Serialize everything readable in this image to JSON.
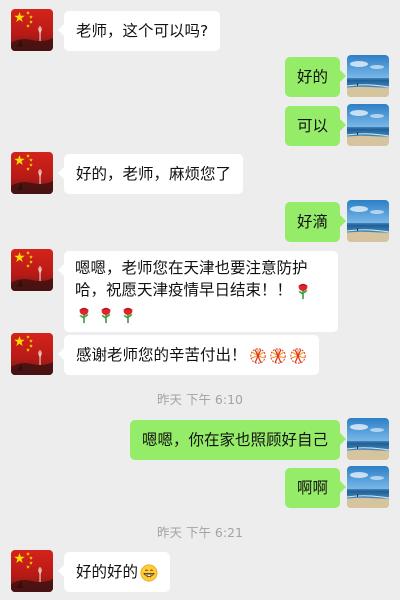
{
  "messages": [
    {
      "side": "in",
      "text": "老师，这个可以吗?"
    },
    {
      "side": "out",
      "text": "好的"
    },
    {
      "side": "out",
      "text": "可以"
    },
    {
      "side": "in",
      "text": "好的，老师，麻烦您了"
    },
    {
      "side": "out",
      "text": "好滴"
    },
    {
      "side": "in",
      "line1": "嗯嗯，老师您在天津也要注意防护",
      "line2": "哈，祝愿天津疫情早日结束！！",
      "emoji": [
        "rose-emoji",
        "rose-emoji",
        "rose-emoji",
        "rose-emoji"
      ]
    },
    {
      "side": "in",
      "text": "感谢老师您的辛苦付出！",
      "emoji": [
        "firecracker-emoji",
        "firecracker-emoji",
        "firecracker-emoji"
      ]
    },
    {
      "side": "out",
      "text": "嗯嗯，你在家也照顾好自己"
    },
    {
      "side": "out",
      "text": "啊啊"
    },
    {
      "side": "in",
      "text": "好的好的",
      "emoji": [
        "grinning-emoji"
      ]
    }
  ],
  "timestamps": [
    "昨天 下午 6:10",
    "昨天 下午 6:21"
  ],
  "colors": {
    "background": "#ededed",
    "outgoing": "#95ec69",
    "incoming": "#ffffff",
    "timestamp": "#a3a3a3"
  }
}
